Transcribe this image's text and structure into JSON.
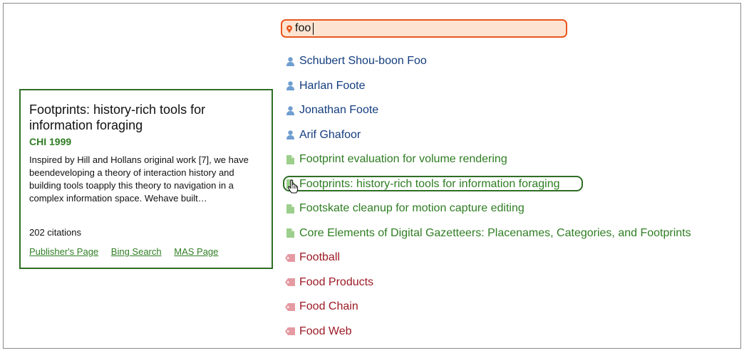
{
  "search": {
    "value": "foo",
    "accent_color": "#e8561f",
    "background_color": "#fde4d2",
    "icon": "location-pin-icon"
  },
  "suggestions": [
    {
      "type": "person",
      "label": "Schubert Shou-boon Foo",
      "icon": "person-icon"
    },
    {
      "type": "person",
      "label": "Harlan Foote",
      "icon": "person-icon"
    },
    {
      "type": "person",
      "label": "Jonathan Foote",
      "icon": "person-icon"
    },
    {
      "type": "person",
      "label": "Arif Ghafoor",
      "icon": "person-icon"
    },
    {
      "type": "paper",
      "label": "Footprint evaluation for volume rendering",
      "icon": "document-icon"
    },
    {
      "type": "paper",
      "label": "Footprints: history-rich tools for information foraging",
      "icon": "document-icon",
      "highlighted": true
    },
    {
      "type": "paper",
      "label": "Footskate cleanup for motion capture editing",
      "icon": "document-icon"
    },
    {
      "type": "paper",
      "label": "Core Elements of Digital Gazetteers: Placenames, Categories, and Footprints",
      "icon": "document-icon"
    },
    {
      "type": "topic",
      "label": "Football",
      "icon": "tag-icon"
    },
    {
      "type": "topic",
      "label": "Food Products",
      "icon": "tag-icon"
    },
    {
      "type": "topic",
      "label": "Food Chain",
      "icon": "tag-icon"
    },
    {
      "type": "topic",
      "label": "Food Web",
      "icon": "tag-icon"
    }
  ],
  "colors": {
    "person": "#143d7e",
    "paper": "#2f7d23",
    "topic": "#9b1a24",
    "highlight_border": "#2f6e25"
  },
  "card": {
    "title": "Footprints: history-rich tools for information foraging",
    "venue": "CHI 1999",
    "abstract": "Inspired by Hill and Hollans original work [7], we have beendeveloping a theory of interaction history and building tools toapply this theory to navigation in a complex information space. Wehave built…",
    "citations": "202 citations",
    "links": [
      "Publisher's Page",
      "Bing Search",
      "MAS Page"
    ]
  }
}
